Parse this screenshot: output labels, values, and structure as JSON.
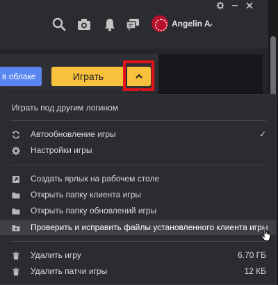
{
  "window": {
    "controls": [
      "gear",
      "minimize",
      "close"
    ]
  },
  "topbar": {
    "icons": [
      "search-icon",
      "camera-icon",
      "bell-icon",
      "chat-icon"
    ],
    "user_name": "Angelin A"
  },
  "game_panel": {
    "cloud_button_label": "в облаке",
    "play_button_label": "Играть"
  },
  "menu": {
    "login_other": "Играть под другим логином",
    "auto_update": "Автообновление игры",
    "auto_update_checked": "✓",
    "game_settings": "Настройки игры",
    "create_shortcut": "Создать ярлык на рабочем столе",
    "open_client_folder": "Открыть папку клиента игры",
    "open_updates_folder": "Открыть папку обновлений игры",
    "verify_files": "Проверить и исправить файлы установленного клиента игры",
    "delete_game": "Удалить игру",
    "delete_game_size": "6.70 ГБ",
    "delete_patches": "Удалить патчи игры",
    "delete_patches_size": "12 КБ"
  },
  "colors": {
    "accent": "#f7c03d",
    "cloud_button": "#5a86f2",
    "highlight": "#e8141b",
    "menu_bg": "#2b2c30"
  }
}
